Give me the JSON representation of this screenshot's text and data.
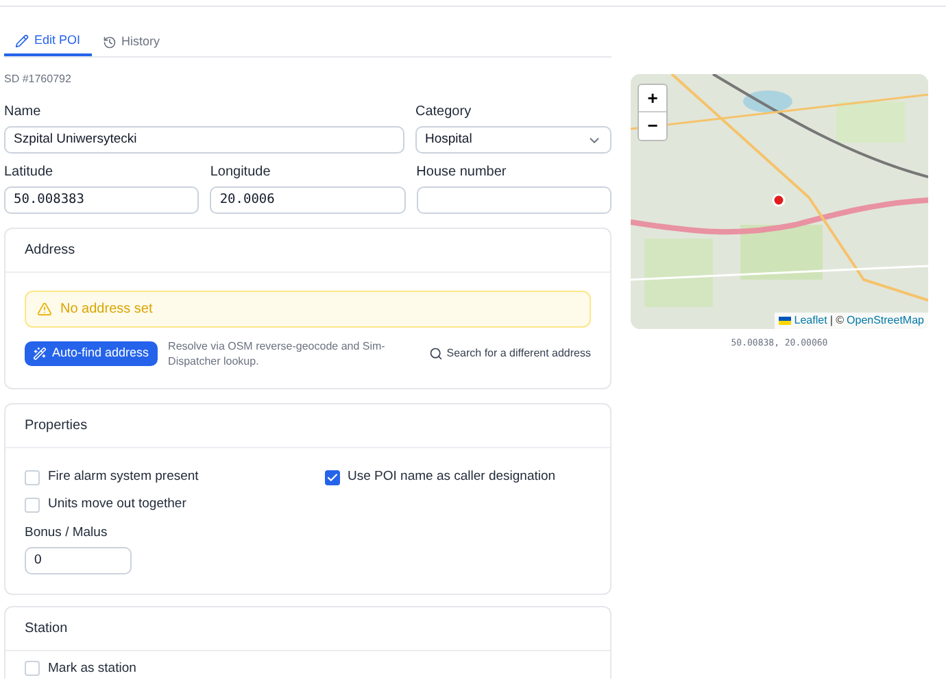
{
  "tabs": [
    {
      "label": "Edit POI",
      "selected": true
    },
    {
      "label": "History",
      "selected": false
    }
  ],
  "record_id": "SD #1760792",
  "fields": {
    "name": {
      "label": "Name",
      "value": "Szpital Uniwersytecki"
    },
    "category": {
      "label": "Category",
      "value": "Hospital"
    },
    "latitude": {
      "label": "Latitude",
      "value": "50.008383"
    },
    "longitude": {
      "label": "Longitude",
      "value": "20.0006"
    },
    "house_number": {
      "label": "House number"
    }
  },
  "address": {
    "title": "Address",
    "alert": "No address set",
    "auto_find_button": "Auto-find address",
    "hint": "Resolve via OSM reverse-geocode and Sim-Dispatcher lookup.",
    "search_link": "Search for a different address"
  },
  "properties": {
    "title": "Properties",
    "left_checkboxes": [
      {
        "label": "Fire alarm system present",
        "checked": false
      },
      {
        "label": "Units move out together",
        "checked": false
      }
    ],
    "right_checkboxes": [
      {
        "label": "Use POI name as caller designation",
        "checked": true
      }
    ],
    "bonus": {
      "label": "Bonus / Malus",
      "value": "0"
    }
  },
  "station": {
    "title": "Station",
    "checkboxes": [
      {
        "label": "Mark as station",
        "checked": false
      }
    ]
  },
  "map": {
    "zoom_in": "+",
    "zoom_out": "−",
    "attribution_leaflet": "Leaflet",
    "attribution_separator": "| ©",
    "attribution_osm": "OpenStreetMap",
    "coordinates": "50.00838, 20.00060"
  }
}
